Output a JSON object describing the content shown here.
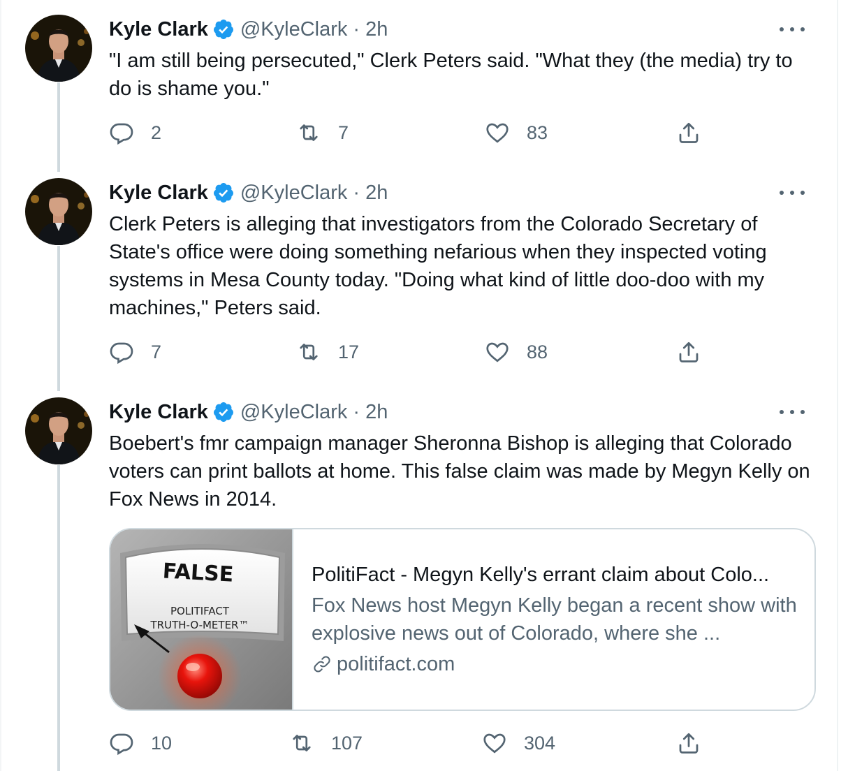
{
  "tweets": [
    {
      "name": "Kyle Clark",
      "handle": "@KyleClark",
      "separator": "·",
      "time": "2h",
      "text": "\"I am still being persecuted,\" Clerk Peters said. \"What they (the media) try to do is shame you.\"",
      "reply_count": "2",
      "retweet_count": "7",
      "like_count": "83"
    },
    {
      "name": "Kyle Clark",
      "handle": "@KyleClark",
      "separator": "·",
      "time": "2h",
      "text": "Clerk Peters is alleging that investigators from the Colorado Secretary of State's office were doing something nefarious when they inspected voting systems in Mesa County today. \"Doing what kind of little doo-doo with my machines,\" Peters said.",
      "reply_count": "7",
      "retweet_count": "17",
      "like_count": "88"
    },
    {
      "name": "Kyle Clark",
      "handle": "@KyleClark",
      "separator": "·",
      "time": "2h",
      "text": "Boebert's fmr campaign manager Sheronna Bishop is alleging that Colorado voters can print ballots at home. This false claim was made by Megyn Kelly on Fox News in 2014.",
      "reply_count": "10",
      "retweet_count": "107",
      "like_count": "304"
    }
  ],
  "card": {
    "image_label_main": "FALSE",
    "image_label_sub1": "POLITIFACT",
    "image_label_sub2": "TRUTH-O-METER™",
    "title": "PolitiFact - Megyn Kelly's errant claim about Colo...",
    "description": "Fox News host Megyn Kelly began a recent show with explosive news out of Colorado, where she ...",
    "domain": "politifact.com"
  },
  "colors": {
    "verified": "#1d9bf0",
    "secondary_text": "#536471",
    "thread_line": "#cfd9de"
  },
  "icons": [
    "verified-badge-icon",
    "more-icon",
    "reply-icon",
    "retweet-icon",
    "like-icon",
    "share-icon",
    "link-icon"
  ]
}
